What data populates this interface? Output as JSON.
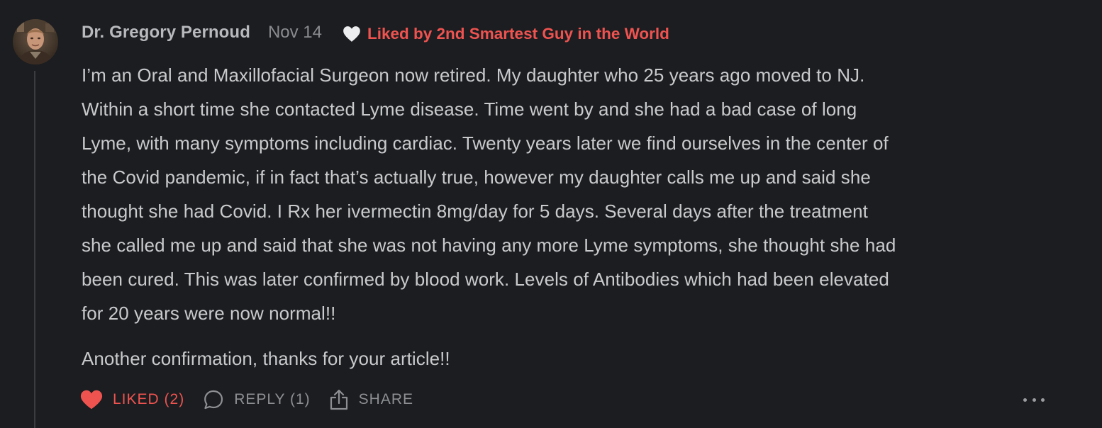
{
  "comment": {
    "author": "Dr. Gregory Pernoud",
    "date": "Nov 14",
    "liked_by": "Liked by 2nd Smartest Guy in the World",
    "body_lines": [
      "I’m an Oral and Maxillofacial Surgeon now retired. My daughter who 25 years ago moved to NJ.",
      "Within a short time she contacted Lyme disease. Time went by and she had a bad case of long",
      "Lyme, with many symptoms including cardiac. Twenty years later we find ourselves in the center of",
      "the Covid pandemic, if in fact that’s actually true, however my daughter calls me up and said she",
      "thought she had Covid. I Rx her ivermectin 8mg/day for 5 days. Several days after the treatment",
      "she called me up and said that she was not having any more Lyme symptoms, she thought she had",
      "been cured. This was later confirmed by blood work. Levels of Antibodies which had been elevated",
      "for 20 years were now normal!!"
    ],
    "body_para2": "Another confirmation, thanks for your article!!",
    "actions": {
      "like_label": "LIKED (2)",
      "reply_label": "REPLY (1)",
      "share_label": "SHARE"
    },
    "icons": {
      "avatar": "avatar-photo",
      "liked_by": "heart-icon",
      "like": "heart-filled-icon",
      "reply": "speech-bubble-icon",
      "share": "share-icon",
      "more": "more-horizontal-icon"
    },
    "colors": {
      "background": "#1b1d20",
      "accent": "#ef5350",
      "text": "#c8cacc",
      "muted": "#8d8f93"
    }
  }
}
